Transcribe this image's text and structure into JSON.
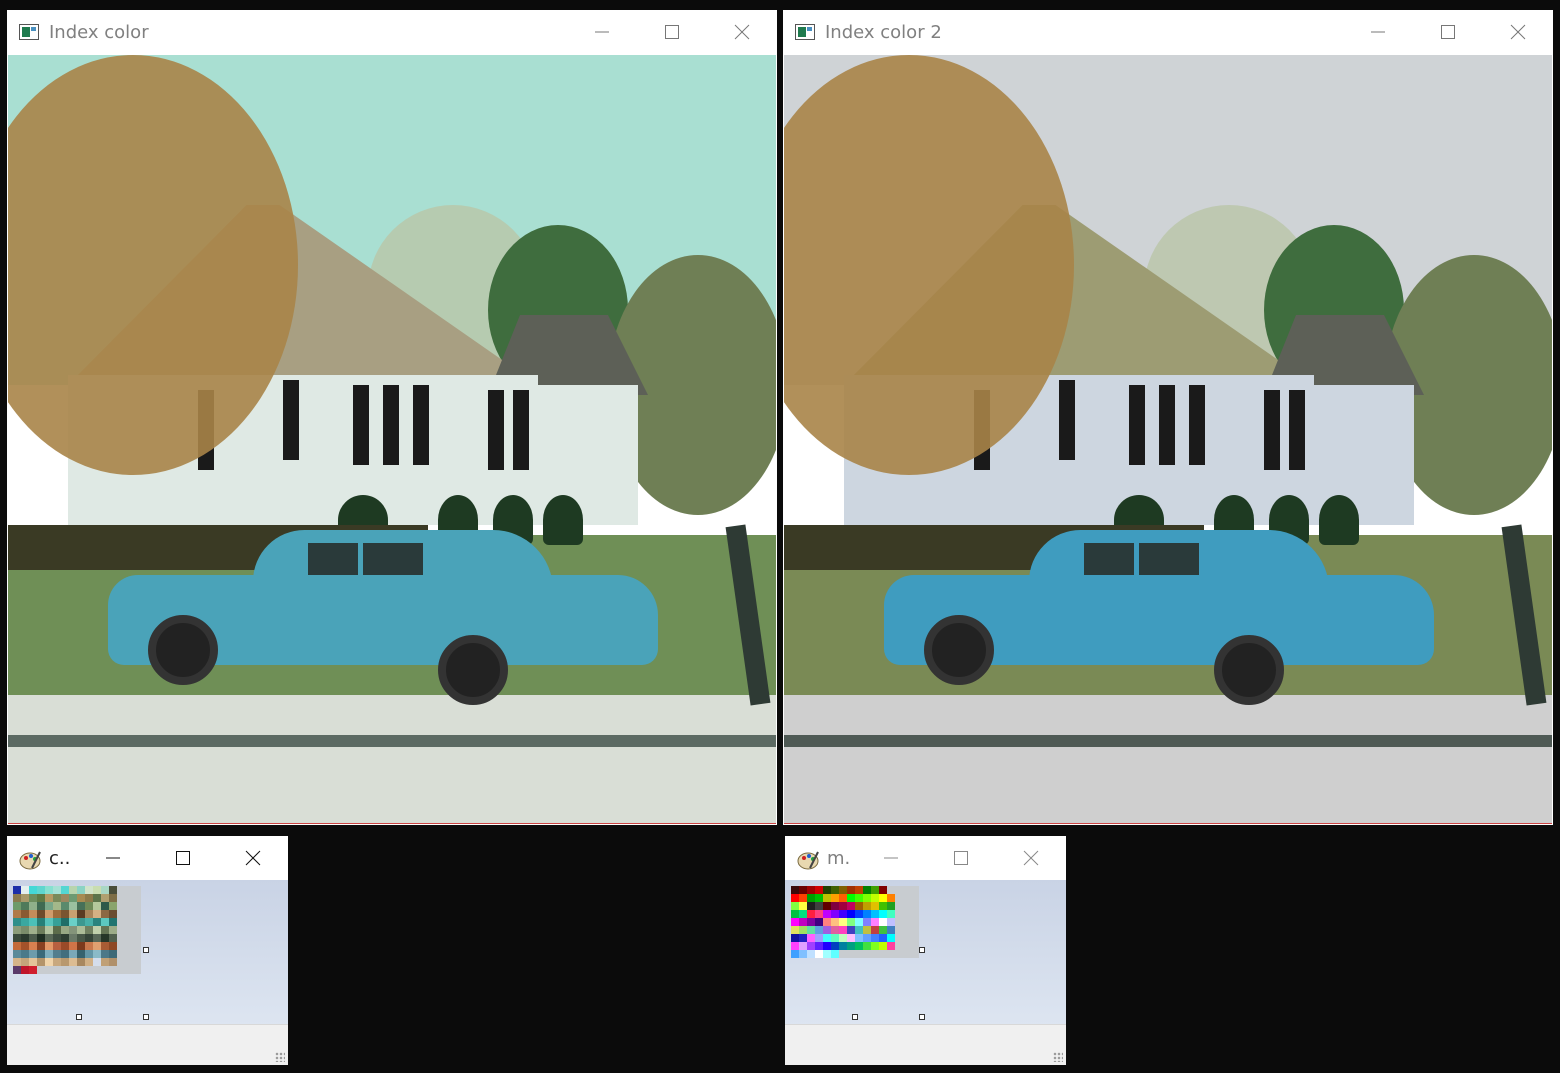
{
  "windows": {
    "index_color": {
      "title": "Index color"
    },
    "index_color_2": {
      "title": "Index color 2"
    },
    "palette_c": {
      "title": "c.."
    },
    "palette_m": {
      "title": "m."
    }
  },
  "controls": {
    "minimize": "minimize-icon",
    "maximize": "maximize-icon",
    "close": "close-icon"
  },
  "colors": {
    "desktop": "#0b0b0b",
    "titlebar": "#ffffff",
    "title_text_inactive": "#808080",
    "scene1": {
      "sky": "#a9dfd2",
      "lawn": "#6f8f56",
      "house": "#dfe9e4",
      "roof": "#a89f82",
      "car": "#4aa3b9",
      "sidewalk": "#d9ded6",
      "road": "#5c6a63"
    },
    "scene2": {
      "sky": "#cfd3d6",
      "lawn": "#7a8a55",
      "house": "#cdd6e0",
      "roof": "#9d9c73",
      "car": "#3f9cbf",
      "sidewalk": "#cfcfcf",
      "road": "#4f5a55"
    }
  },
  "palette_c": {
    "cols": 16,
    "swatches": [
      "#1c2fa8",
      "#e4f0ee",
      "#44d8d6",
      "#5ed6cf",
      "#86e0d0",
      "#a6e1d5",
      "#54d6d2",
      "#b8d4ad",
      "#8bd3c4",
      "#d0e3c9",
      "#c9ddb0",
      "#a9d7c4",
      "#4a4e3a",
      "#c8ccd0",
      "#c8ccd0",
      "#c8ccd0",
      "#8a7a4e",
      "#a89a6a",
      "#6d8e5e",
      "#5e7a45",
      "#b59a64",
      "#7a8a5a",
      "#9b8860",
      "#6c9a72",
      "#a78b52",
      "#8c7a4a",
      "#5c744a",
      "#b0a070",
      "#7e6e46",
      "#c8ccd0",
      "#c8ccd0",
      "#c8ccd0",
      "#6e9a6a",
      "#4f7a5a",
      "#8fb08a",
      "#3f6a52",
      "#7aa88a",
      "#a4b88a",
      "#5a8a6c",
      "#9ac0a0",
      "#467058",
      "#6e8a58",
      "#b4c89c",
      "#2e5a4a",
      "#8aa46c",
      "#c8ccd0",
      "#c8ccd0",
      "#c8ccd0",
      "#b07a4a",
      "#8a5a32",
      "#c48c5a",
      "#6e4a2a",
      "#d09c6c",
      "#9e6c3c",
      "#7a5430",
      "#c8a070",
      "#5a3a22",
      "#a8845a",
      "#d4b084",
      "#8c6844",
      "#6a4c30",
      "#c8ccd0",
      "#c8ccd0",
      "#c8ccd0",
      "#2f8f8a",
      "#3aa8a0",
      "#4cc0b8",
      "#268078",
      "#58c4bc",
      "#36a098",
      "#1e6e68",
      "#6ad0c8",
      "#3c9890",
      "#48b0a8",
      "#2a847e",
      "#5cc8c0",
      "#207470",
      "#c8ccd0",
      "#c8ccd0",
      "#c8ccd0",
      "#8c9c7a",
      "#7a8c6a",
      "#a0b08c",
      "#6c7c5a",
      "#b4c4a0",
      "#5c6c4a",
      "#98a884",
      "#84947a",
      "#acbc98",
      "#708060",
      "#c0d0ac",
      "#647454",
      "#9cac88",
      "#c8ccd0",
      "#c8ccd0",
      "#c8ccd0",
      "#3a4a3c",
      "#2a3a2e",
      "#4c5c4c",
      "#1e2e22",
      "#5a6a58",
      "#3e4e40",
      "#2e3e32",
      "#6a7a68",
      "#485848",
      "#344438",
      "#586858",
      "#263628",
      "#50604e",
      "#c8ccd0",
      "#c8ccd0",
      "#c8ccd0",
      "#c46a3a",
      "#a4522a",
      "#d88050",
      "#8a4020",
      "#e49868",
      "#b86040",
      "#9a4a28",
      "#d07448",
      "#7c3a1c",
      "#c8784c",
      "#e0a070",
      "#a85c34",
      "#8e4824",
      "#c8ccd0",
      "#c8ccd0",
      "#c8ccd0",
      "#5a8a9a",
      "#4a7a8a",
      "#6c9cac",
      "#3a6a7a",
      "#7eaebe",
      "#527e8e",
      "#426e7e",
      "#7aa8b8",
      "#36626e",
      "#6496a6",
      "#8abac8",
      "#4c7888",
      "#3e6a78",
      "#c8ccd0",
      "#c8ccd0",
      "#c8ccd0",
      "#d4b48a",
      "#c4a47a",
      "#e4c49a",
      "#b4946a",
      "#f0d4aa",
      "#c8a87e",
      "#b8986e",
      "#dcbc92",
      "#a88860",
      "#d0b086",
      "#ecccа2",
      "#c0a076",
      "#b0906a",
      "#c8ccd0",
      "#c8ccd0",
      "#c8ccd0",
      "#5a3a6a",
      "#c0142a",
      "#d01e2e",
      "#c8ccd0",
      "#c8ccd0",
      "#c8ccd0",
      "#c8ccd0",
      "#c8ccd0",
      "#c8ccd0",
      "#c8ccd0",
      "#c8ccd0",
      "#c8ccd0",
      "#c8ccd0",
      "#c8ccd0",
      "#c8ccd0",
      "#c8ccd0"
    ]
  },
  "palette_m": {
    "cols": 16,
    "swatches": [
      "#3a0a0a",
      "#6a0000",
      "#a00000",
      "#d00000",
      "#204000",
      "#406000",
      "#806000",
      "#a03000",
      "#c04000",
      "#008000",
      "#40a000",
      "#800000",
      "#c8ccd0",
      "#c8ccd0",
      "#c8ccd0",
      "#c8ccd0",
      "#ff0000",
      "#ff4000",
      "#00a000",
      "#00c000",
      "#c0c000",
      "#ffa000",
      "#ff6000",
      "#00ff00",
      "#40ff00",
      "#80ff00",
      "#c0ff00",
      "#ffff00",
      "#ff8000",
      "#c8ccd0",
      "#c8ccd0",
      "#c8ccd0",
      "#80ff40",
      "#ffff40",
      "#202020",
      "#404040",
      "#600000",
      "#800040",
      "#a00040",
      "#c00060",
      "#a06000",
      "#c0a000",
      "#e0c000",
      "#40c000",
      "#20a020",
      "#c8ccd0",
      "#c8ccd0",
      "#c8ccd0",
      "#00c040",
      "#00e080",
      "#ff2040",
      "#ff4080",
      "#c000ff",
      "#8000ff",
      "#4000ff",
      "#0000ff",
      "#0040ff",
      "#0080ff",
      "#00c0ff",
      "#00ffff",
      "#40ffc0",
      "#c8ccd0",
      "#c8ccd0",
      "#c8ccd0",
      "#ff00ff",
      "#c000c0",
      "#8000a0",
      "#400080",
      "#ff8080",
      "#ffc080",
      "#ffff80",
      "#80ff80",
      "#80ffff",
      "#8080ff",
      "#ff80ff",
      "#ffffff",
      "#c0c0ff",
      "#c8ccd0",
      "#c8ccd0",
      "#c8ccd0",
      "#e0e060",
      "#a0e060",
      "#60e0a0",
      "#60a0e0",
      "#a060e0",
      "#e060a0",
      "#ff40c0",
      "#4040c0",
      "#40c0c0",
      "#c0c040",
      "#c04040",
      "#40c040",
      "#4080c0",
      "#c8ccd0",
      "#c8ccd0",
      "#c8ccd0",
      "#1010a0",
      "#2020c0",
      "#ff60ff",
      "#a0a0ff",
      "#40ffff",
      "#60ffc0",
      "#c0ffc0",
      "#ffc0ff",
      "#80c0ff",
      "#60a0ff",
      "#4080ff",
      "#2060ff",
      "#00ffff",
      "#c8ccd0",
      "#c8ccd0",
      "#c8ccd0",
      "#ff40ff",
      "#e0a0ff",
      "#a040ff",
      "#6020ff",
      "#2000ff",
      "#0040c0",
      "#0080a0",
      "#00a080",
      "#00c060",
      "#40e040",
      "#80ff20",
      "#c0ff00",
      "#ff40a0",
      "#c8ccd0",
      "#c8ccd0",
      "#c8ccd0",
      "#40a0ff",
      "#80c0ff",
      "#c0e0ff",
      "#ffffff",
      "#a0ffff",
      "#60ffff",
      "#c8ccd0",
      "#c8ccd0",
      "#c8ccd0",
      "#c8ccd0",
      "#c8ccd0",
      "#c8ccd0",
      "#c8ccd0",
      "#c8ccd0",
      "#c8ccd0",
      "#c8ccd0"
    ]
  }
}
